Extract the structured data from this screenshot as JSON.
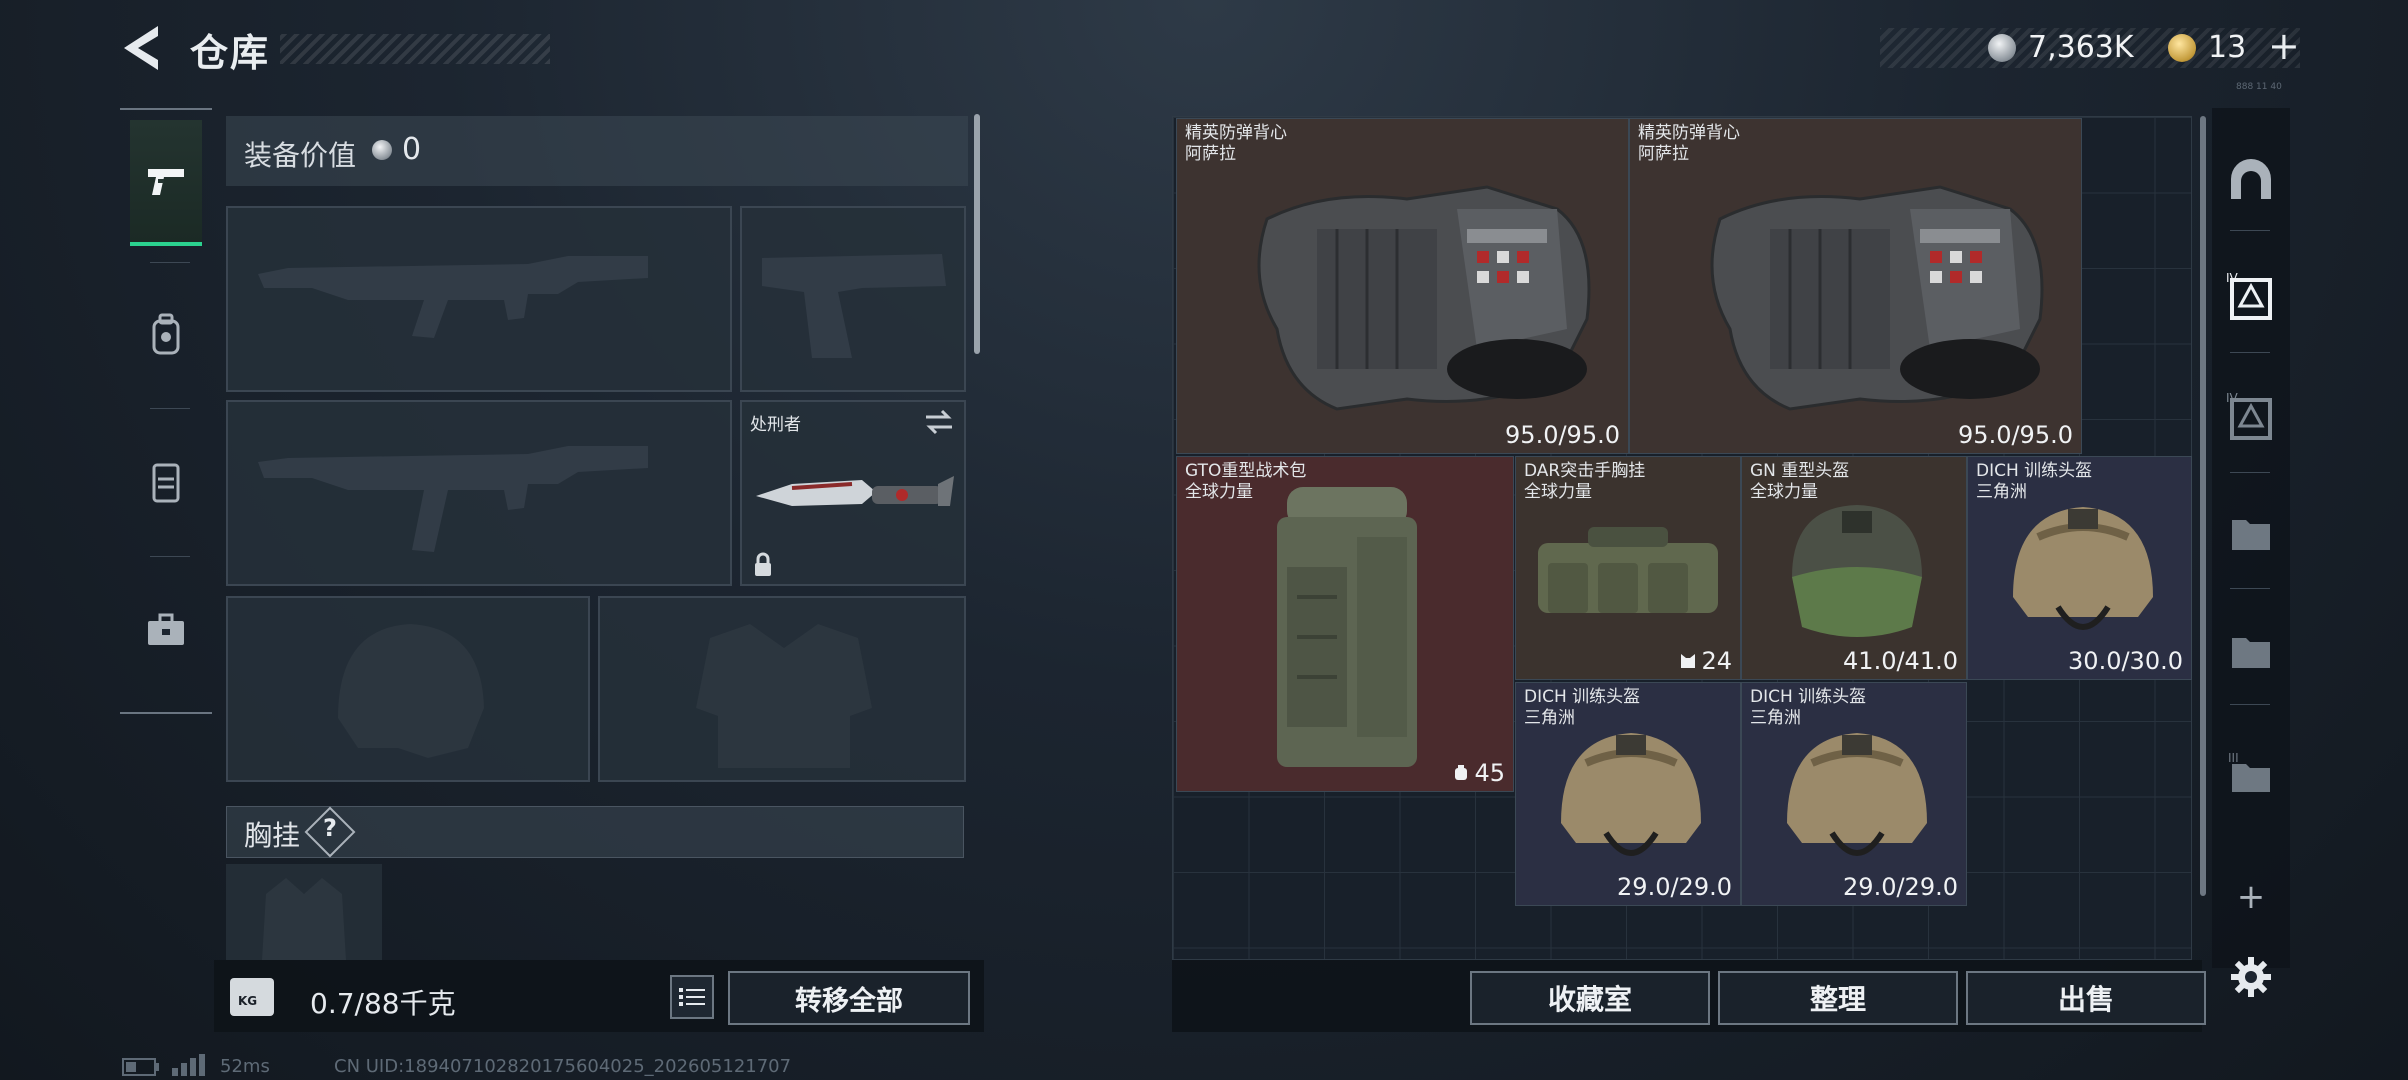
{
  "header": {
    "title": "仓库",
    "silver_amount": "7,363K",
    "gold_amount": "13",
    "plus_label": "+",
    "tiny_version": "888 11 40"
  },
  "left_tabs": [
    {
      "icon": "pistol-icon",
      "active": true
    },
    {
      "icon": "backpack-icon",
      "active": false
    },
    {
      "icon": "vest-icon",
      "active": false
    },
    {
      "icon": "case-icon",
      "active": false
    }
  ],
  "equipment": {
    "value_label": "装备价值",
    "value": "0",
    "melee_slot_label": "处刑者",
    "chest_label": "胸挂",
    "help_label": "?",
    "weight": "0.7/88千克",
    "weight_unit": "KG",
    "transfer_all_label": "转移全部"
  },
  "stash_items": [
    {
      "name_line1": "精英防弹背心",
      "name_line2": "阿萨拉",
      "value": "95.0/95.0",
      "kind": "vest"
    },
    {
      "name_line1": "精英防弹背心",
      "name_line2": "阿萨拉",
      "value": "95.0/95.0",
      "kind": "vest"
    },
    {
      "name_line1": "GTO重型战术包",
      "name_line2": "全球力量",
      "value": "45",
      "kind": "backpack"
    },
    {
      "name_line1": "DAR突击手胸挂",
      "name_line2": "全球力量",
      "value": "24",
      "kind": "chestrig"
    },
    {
      "name_line1": "GN 重型头盔",
      "name_line2": "全球力量",
      "value": "41.0/41.0",
      "kind": "heavy-helmet"
    },
    {
      "name_line1": "DICH 训练头盔",
      "name_line2": "三角洲",
      "value": "30.0/30.0",
      "kind": "helmet"
    },
    {
      "name_line1": "DICH 训练头盔",
      "name_line2": "三角洲",
      "value": "29.0/29.0",
      "kind": "helmet"
    },
    {
      "name_line1": "DICH 训练头盔",
      "name_line2": "三角洲",
      "value": "29.0/29.0",
      "kind": "helmet"
    }
  ],
  "bottom_buttons": {
    "collection": "收藏室",
    "organize": "整理",
    "sell": "出售"
  },
  "status_bar": {
    "ping": "52ms",
    "uid": "CN UID:18940710282017560402​5_202605121707"
  },
  "colors": {
    "accent_green": "#2bd28f",
    "rarity_brown": "#3d3330",
    "rarity_red": "#4a2b2d",
    "rarity_blue": "#2b2f43"
  }
}
